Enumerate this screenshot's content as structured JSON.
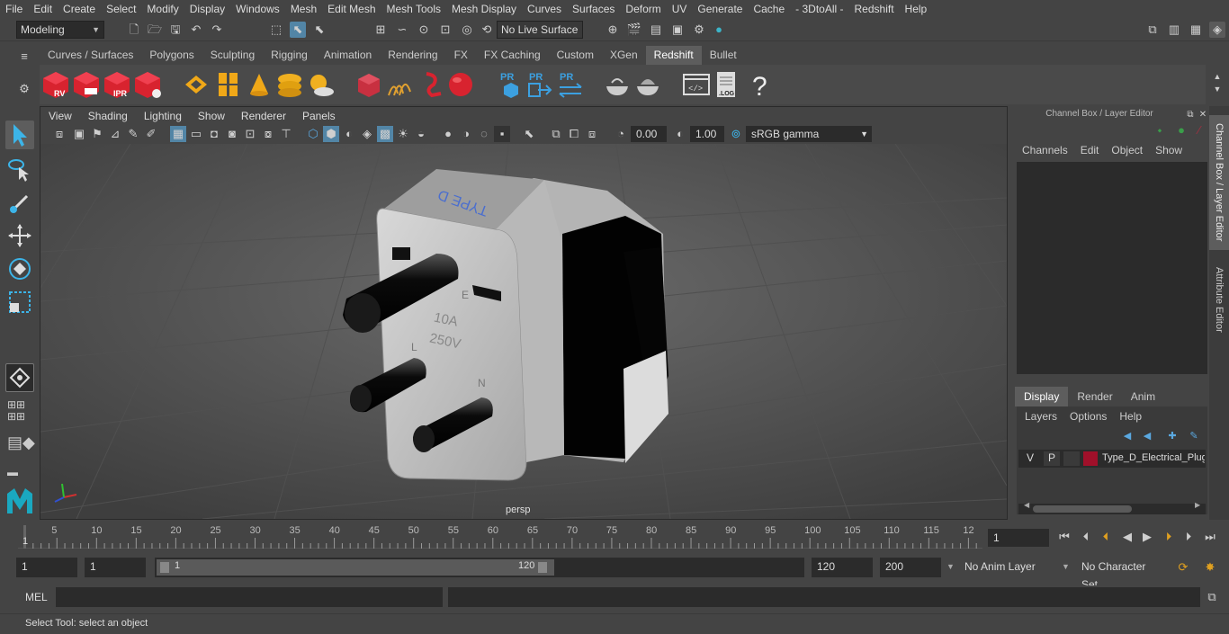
{
  "menubar": [
    "File",
    "Edit",
    "Create",
    "Select",
    "Modify",
    "Display",
    "Windows",
    "Mesh",
    "Edit Mesh",
    "Mesh Tools",
    "Mesh Display",
    "Curves",
    "Surfaces",
    "Deform",
    "UV",
    "Generate",
    "Cache",
    "- 3DtoAll -",
    "Redshift",
    "Help"
  ],
  "status": {
    "mode": "Modeling",
    "live_surface": "No Live Surface"
  },
  "shelf_tabs": [
    "Curves / Surfaces",
    "Polygons",
    "Sculpting",
    "Rigging",
    "Animation",
    "Rendering",
    "FX",
    "FX Caching",
    "Custom",
    "XGen",
    "Redshift",
    "Bullet"
  ],
  "shelf_active": "Redshift",
  "shelf_labels": {
    "rv": "RV",
    "ipr": "IPR",
    "pr": "PR",
    "log": ".LOG",
    "help": "?"
  },
  "panel_menu": [
    "View",
    "Shading",
    "Lighting",
    "Show",
    "Renderer",
    "Panels"
  ],
  "panel_tools": {
    "exposure": "0.00",
    "gamma": "1.00",
    "color_space": "sRGB gamma"
  },
  "viewport": {
    "camera": "persp",
    "plug_text_type": "TYPE D",
    "plug_rating_a": "10A",
    "plug_rating_v": "250V",
    "pin_e": "E",
    "pin_l": "L",
    "pin_n": "N"
  },
  "channel_box": {
    "title": "Channel Box / Layer Editor",
    "menu": [
      "Channels",
      "Edit",
      "Object",
      "Show"
    ]
  },
  "layer_editor": {
    "tabs": [
      "Display",
      "Render",
      "Anim"
    ],
    "active_tab": "Display",
    "menu": [
      "Layers",
      "Options",
      "Help"
    ],
    "layer": {
      "v": "V",
      "p": "P",
      "name": "Type_D_Electrical_Plug",
      "color": "#a0102a"
    }
  },
  "side_tabs": [
    "Channel Box / Layer Editor",
    "Attribute Editor"
  ],
  "timeline": {
    "ticks": [
      "5",
      "10",
      "15",
      "20",
      "25",
      "30",
      "35",
      "40",
      "45",
      "50",
      "55",
      "60",
      "65",
      "70",
      "75",
      "80",
      "85",
      "90",
      "95",
      "100",
      "105",
      "110",
      "115",
      "12"
    ],
    "current": "1",
    "start_marker": "1",
    "frame_field": "1"
  },
  "range": {
    "start": "1",
    "start2": "1",
    "slider_start": "1",
    "slider_end": "120",
    "end": "120",
    "max": "200",
    "anim_layer": "No Anim Layer",
    "char_set": "No Character Set"
  },
  "cmdline": {
    "label": "MEL"
  },
  "helpline": {
    "text": "Select Tool: select an object"
  },
  "colors": {
    "accent": "#5285a6",
    "active_tab": "#5d5d5d",
    "redshift_red": "#d8232f",
    "layer_red": "#a0102a"
  }
}
